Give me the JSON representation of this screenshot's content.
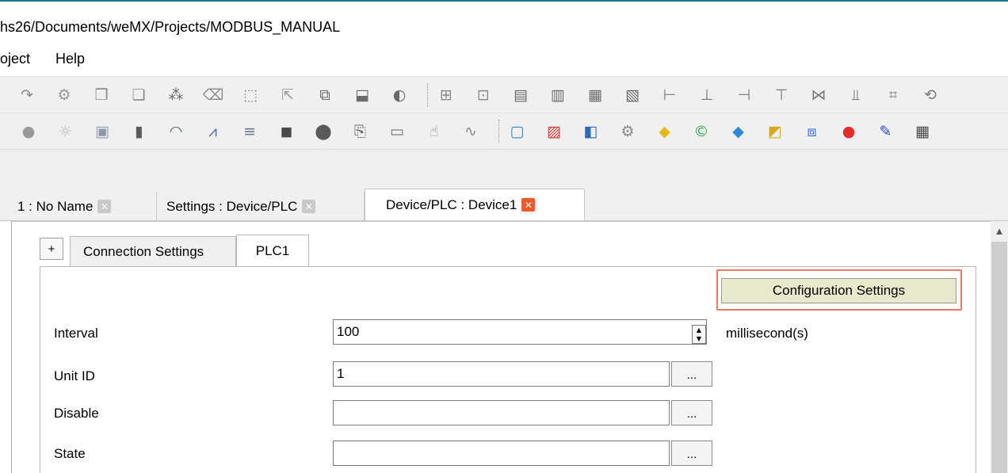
{
  "window": {
    "title": "hs26/Documents/weMX/Projects/MODBUS_MANUAL"
  },
  "menu": [
    {
      "label": "oject"
    },
    {
      "label": "Help"
    }
  ],
  "toolbar1": [
    {
      "name": "redo-icon",
      "glyph": "↷",
      "color": "#8a8a8a"
    },
    {
      "name": "zoom-icon",
      "glyph": "⚙",
      "color": "#9a9a9a"
    },
    {
      "name": "copy-format-icon",
      "glyph": "❐",
      "color": "#8a8a8a"
    },
    {
      "name": "paste-format-icon",
      "glyph": "❏",
      "color": "#8a8a8a"
    },
    {
      "name": "group-icon",
      "glyph": "⁂",
      "color": "#6a6a6a"
    },
    {
      "name": "delete-icon",
      "glyph": "⌫",
      "color": "#8a8a8a"
    },
    {
      "name": "select-icon",
      "glyph": "⬚",
      "color": "#8a8a8a"
    },
    {
      "name": "pointer-icon",
      "glyph": "⇱",
      "color": "#9a9a9a"
    },
    {
      "name": "bring-front-icon",
      "glyph": "⧉",
      "color": "#6a6a6a"
    },
    {
      "name": "send-back-icon",
      "glyph": "⬓",
      "color": "#6a6a6a"
    },
    {
      "name": "rotate-icon",
      "glyph": "◐",
      "color": "#6a6a6a"
    },
    {
      "name": "sep",
      "glyph": ""
    },
    {
      "name": "align-grid-icon",
      "glyph": "⊞",
      "color": "#8a8a8a"
    },
    {
      "name": "align-grid2-icon",
      "glyph": "⊡",
      "color": "#8a8a8a"
    },
    {
      "name": "size-icon",
      "glyph": "▤",
      "color": "#6a6a6a"
    },
    {
      "name": "size2-icon",
      "glyph": "▥",
      "color": "#6a6a6a"
    },
    {
      "name": "size3-icon",
      "glyph": "▦",
      "color": "#6a6a6a"
    },
    {
      "name": "size4-icon",
      "glyph": "▧",
      "color": "#6a6a6a"
    },
    {
      "name": "align-left-icon",
      "glyph": "⊢",
      "color": "#7a7a7a"
    },
    {
      "name": "align-center-icon",
      "glyph": "⊥",
      "color": "#7a7a7a"
    },
    {
      "name": "align-right-icon",
      "glyph": "⊣",
      "color": "#7a7a7a"
    },
    {
      "name": "align-top-icon",
      "glyph": "⊤",
      "color": "#7a7a7a"
    },
    {
      "name": "align-middle-icon",
      "glyph": "⋈",
      "color": "#7a7a7a"
    },
    {
      "name": "align-bottom-icon",
      "glyph": "⫫",
      "color": "#7a7a7a"
    },
    {
      "name": "distribute-icon",
      "glyph": "⌗",
      "color": "#8a8a8a"
    },
    {
      "name": "flip-icon",
      "glyph": "⟲",
      "color": "#7a7a7a"
    }
  ],
  "toolbar2": [
    {
      "name": "lamp-icon",
      "glyph": "●",
      "color": "#9a9a9a"
    },
    {
      "name": "light-icon",
      "glyph": "☼",
      "color": "#b8b8b8"
    },
    {
      "name": "image-icon",
      "glyph": "▣",
      "color": "#8a9aaa"
    },
    {
      "name": "bar-graph-icon",
      "glyph": "▮",
      "color": "#5a5a5a"
    },
    {
      "name": "gauge-icon",
      "glyph": "◠",
      "color": "#5a6a7a"
    },
    {
      "name": "trend-icon",
      "glyph": "⩘",
      "color": "#3a6a9a"
    },
    {
      "name": "slider-icon",
      "glyph": "≡",
      "color": "#6a7a8a"
    },
    {
      "name": "text-box-icon",
      "glyph": "◼",
      "color": "#4a4a4a"
    },
    {
      "name": "alarm-icon",
      "glyph": "⬤",
      "color": "#5a5a5a"
    },
    {
      "name": "report-icon",
      "glyph": "⎘",
      "color": "#6a6a6a"
    },
    {
      "name": "monitor-icon",
      "glyph": "▭",
      "color": "#6a7a6a"
    },
    {
      "name": "hand-icon",
      "glyph": "☝",
      "color": "#8a8a8a"
    },
    {
      "name": "waveform-icon",
      "glyph": "∿",
      "color": "#8a8a8a"
    },
    {
      "name": "sep",
      "glyph": ""
    },
    {
      "name": "screen-icon",
      "glyph": "▢",
      "color": "#2a8ac8"
    },
    {
      "name": "screen-edit-icon",
      "glyph": "▨",
      "color": "#c83a3a"
    },
    {
      "name": "windows-icon",
      "glyph": "◧",
      "color": "#2a6ab8"
    },
    {
      "name": "settings-gear-icon",
      "glyph": "⚙",
      "color": "#8a8a8a"
    },
    {
      "name": "tag-icon",
      "glyph": "◆",
      "color": "#e8b81a"
    },
    {
      "name": "copyright-icon",
      "glyph": "©",
      "color": "#2aa84a"
    },
    {
      "name": "tag-blue-icon",
      "glyph": "◆",
      "color": "#2a8ad8"
    },
    {
      "name": "device-icon",
      "glyph": "◩",
      "color": "#d8a81a"
    },
    {
      "name": "network-icon",
      "glyph": "⧈",
      "color": "#2a6ad8"
    },
    {
      "name": "alarm-light-icon",
      "glyph": "●",
      "color": "#e82a2a"
    },
    {
      "name": "script-icon",
      "glyph": "✎",
      "color": "#2a4ac8"
    },
    {
      "name": "calendar-icon",
      "glyph": "▦",
      "color": "#4a4a4a"
    }
  ],
  "doc_tabs": [
    {
      "label": "1 : No Name",
      "active": false
    },
    {
      "label": "Settings : Device/PLC",
      "active": false
    },
    {
      "label": "Device/PLC : Device1",
      "active": true
    }
  ],
  "inner_tabs": {
    "plus": "+",
    "connection": "Connection Settings",
    "plc": "PLC1"
  },
  "config_button": "Configuration Settings",
  "fields": {
    "interval": {
      "label": "Interval",
      "value": "100",
      "unit": "millisecond(s)"
    },
    "unit_id": {
      "label": "Unit ID",
      "value": "1"
    },
    "disable": {
      "label": "Disable",
      "value": ""
    },
    "state": {
      "label": "State",
      "value": ""
    }
  },
  "ellipsis": "...",
  "colors": {
    "accent_border": "#e87a66",
    "config_button_bg": "#e8e8cc",
    "tab_close_active": "#f05a2a"
  }
}
